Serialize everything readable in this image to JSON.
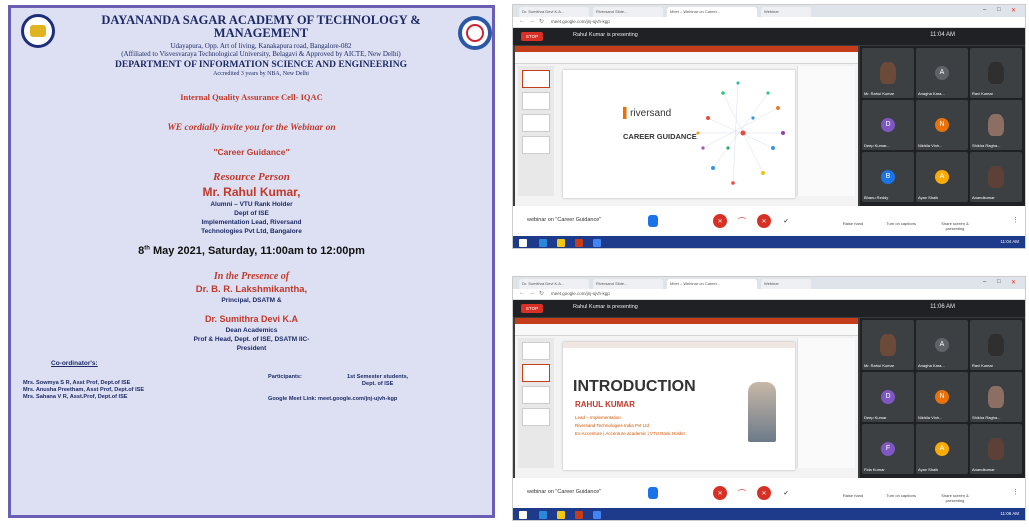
{
  "poster": {
    "college": "DAYANANDA SAGAR ACADEMY OF TECHNOLOGY & MANAGEMENT",
    "address": "Udayapura, Opp. Art of living, Kanakapura road, Bangalore-082",
    "affiliation": "(Affiliated to Visvesvaraya Technological University, Belagavi & Approved by AICTE, New Delhi)",
    "department": "DEPARTMENT OF INFORMATION SCIENCE AND ENGINEERING",
    "accreditation": "Accredited 3 years by NBA, New Delhi",
    "iqac": "Internal Quality Assurance Cell- IQAC",
    "invite": "WE cordially invite you for the Webinar on",
    "webinar_title": "\"Career Guidance\"",
    "rp_heading": "Resource Person",
    "speaker": "Mr. Rahul Kumar,",
    "speaker_lines": [
      "Alumni – VTU Rank Holder",
      "Dept of ISE",
      "Implementation Lead, Riversand",
      "Technologies Pvt Ltd, Bangalore"
    ],
    "date_day": "8",
    "date_sup": "th",
    "date_rest": "May 2021, Saturday, 11:00am to 12:00pm",
    "presence": "In the Presence of",
    "principal_name": "Dr. B. R. Lakshmikantha,",
    "principal_role": "Principal, DSATM &",
    "dean_name": "Dr. Sumithra Devi K.A",
    "dean_lines": [
      "Dean Academics",
      "Prof & Head, Dept. of ISE, DSATM IIC-",
      "President"
    ],
    "coordinators_label": "Co-ordinator's:",
    "coordinators": [
      "Mrs. Sowmya S R, Asst Prof, Dept.of ISE",
      "Mrs. Anusha Preetham, Asst Prof, Dept.of ISE",
      "Mrs. Sahana V R, Asst.Prof, Dept.of ISE"
    ],
    "participants_label": "Participants:",
    "participants_value": "1st Semester students,",
    "participants_dept": "Dept. of ISE",
    "meet_link": "Google Meet Link: meet.google.com/jnj-ujvh-kgp"
  },
  "screens": [
    {
      "tabs": [
        "Dr. Sumithra Devi K.A...",
        "Riversand Slide...",
        "Meet – Webinar on Career...",
        "Webinar"
      ],
      "url": "meet.google.com/jnj-ujvh-kgp",
      "stop_label": "STOP",
      "presenting": "Rahul Kumar is presenting",
      "time": "11:04 AM",
      "slide_brand": "riversand",
      "slide_title": "CAREER GUIDANCE",
      "meeting_name": "webinar on \"Career Guidance\"",
      "participants": [
        {
          "name": "Mr. Rahul Kumar",
          "type": "face",
          "color": "#6b4a3a"
        },
        {
          "name": "Anagha Kara...",
          "type": "letter",
          "letter": "A",
          "color": "#5f6368"
        },
        {
          "name": "Ravi Kumar",
          "type": "face",
          "color": "#2f2f2f"
        },
        {
          "name": "Deep Kumar...",
          "type": "letter",
          "letter": "D",
          "color": "#7e57c2"
        },
        {
          "name": "Nikhila Vinh...",
          "type": "letter",
          "letter": "N",
          "color": "#e8710a"
        },
        {
          "name": "Shikha Ragha...",
          "type": "face",
          "color": "#8d6e63"
        },
        {
          "name": "Bhanu Reddy",
          "type": "letter",
          "letter": "B",
          "color": "#1a73e8"
        },
        {
          "name": "Ayan Shaik",
          "type": "letter",
          "letter": "A",
          "color": "#f9ab00"
        },
        {
          "name": "Anandkumar",
          "type": "face",
          "color": "#5d4037"
        }
      ],
      "controls": [
        "Raise hand",
        "Turn on captions",
        "Share screen & presenting"
      ],
      "clock": "11:04 AM"
    },
    {
      "tabs": [
        "Dr. Sumithra Devi K.A...",
        "Riversand Slide...",
        "Meet – Webinar on Career...",
        "Webinar"
      ],
      "url": "meet.google.com/jnj-ujvh-kgp",
      "stop_label": "STOP",
      "presenting": "Rahul Kumar is presenting",
      "time": "11:06 AM",
      "slide_title": "INTRODUCTION",
      "slide_name": "RAHUL KUMAR",
      "slide_lines": [
        "Lead – Implementation",
        "Riversand Technologies India Pvt Ltd",
        "Ex-Accenture | Accenture academic | VTU Rank Holder"
      ],
      "meeting_name": "webinar on \"Career Guidance\"",
      "participants": [
        {
          "name": "Mr. Rahul Kumar",
          "type": "face",
          "color": "#6b4a3a"
        },
        {
          "name": "Anagha Kara...",
          "type": "letter",
          "letter": "A",
          "color": "#5f6368"
        },
        {
          "name": "Ravi Kumar",
          "type": "face",
          "color": "#2f2f2f"
        },
        {
          "name": "Deep Kumar",
          "type": "letter",
          "letter": "D",
          "color": "#7e57c2"
        },
        {
          "name": "Nikhila Vinh...",
          "type": "letter",
          "letter": "N",
          "color": "#e8710a"
        },
        {
          "name": "Shikha Ragha...",
          "type": "face",
          "color": "#8d6e63"
        },
        {
          "name": "Fida Kumar",
          "type": "letter",
          "letter": "F",
          "color": "#7e57c2"
        },
        {
          "name": "Ayan Shaik",
          "type": "letter",
          "letter": "A",
          "color": "#f9ab00"
        },
        {
          "name": "Anandkumar",
          "type": "face",
          "color": "#5d4037"
        }
      ],
      "controls": [
        "Raise hand",
        "Turn on captions",
        "Share screen & presenting"
      ],
      "clock": "11:06 AM"
    }
  ],
  "colors": {
    "poster_border": "#6a5eb4",
    "poster_bg": "#dde0f3",
    "accent_red": "#c0392b",
    "navy": "#1d2a66",
    "meet_red": "#d93025",
    "taskbar": "#1e3a8a"
  }
}
